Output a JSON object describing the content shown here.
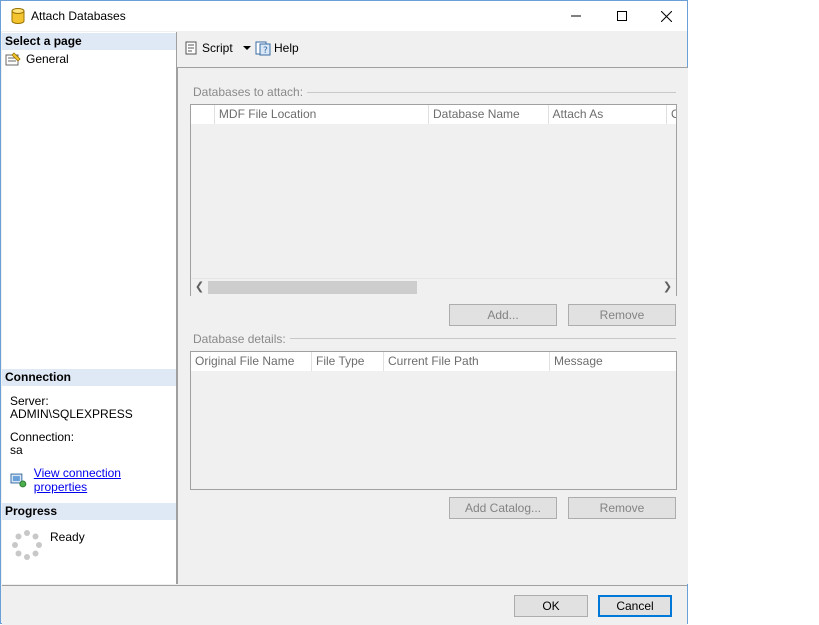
{
  "window": {
    "title": "Attach Databases"
  },
  "left_pane": {
    "select_page_header": "Select a page",
    "pages": [
      {
        "label": "General"
      }
    ],
    "connection_header": "Connection",
    "server_label": "Server:",
    "server_value": "ADMIN\\SQLEXPRESS",
    "connection_label": "Connection:",
    "connection_value": "sa",
    "view_connection_link": "View connection properties",
    "progress_header": "Progress",
    "progress_status": "Ready"
  },
  "toolbar": {
    "script_label": "Script",
    "help_label": "Help"
  },
  "databases_to_attach": {
    "group_label": "Databases to attach:",
    "columns": [
      "MDF File Location",
      "Database Name",
      "Attach As",
      "O"
    ],
    "add_button": "Add...",
    "remove_button": "Remove"
  },
  "database_details": {
    "group_label": "Database details:",
    "columns": [
      "Original File Name",
      "File Type",
      "Current File Path",
      "Message"
    ],
    "add_catalog_button": "Add Catalog...",
    "remove_button": "Remove"
  },
  "footer": {
    "ok_button": "OK",
    "cancel_button": "Cancel"
  },
  "colors": {
    "accent": "#0078d7",
    "link": "#0000ee",
    "section_header_bg": "#dfe8f5"
  }
}
